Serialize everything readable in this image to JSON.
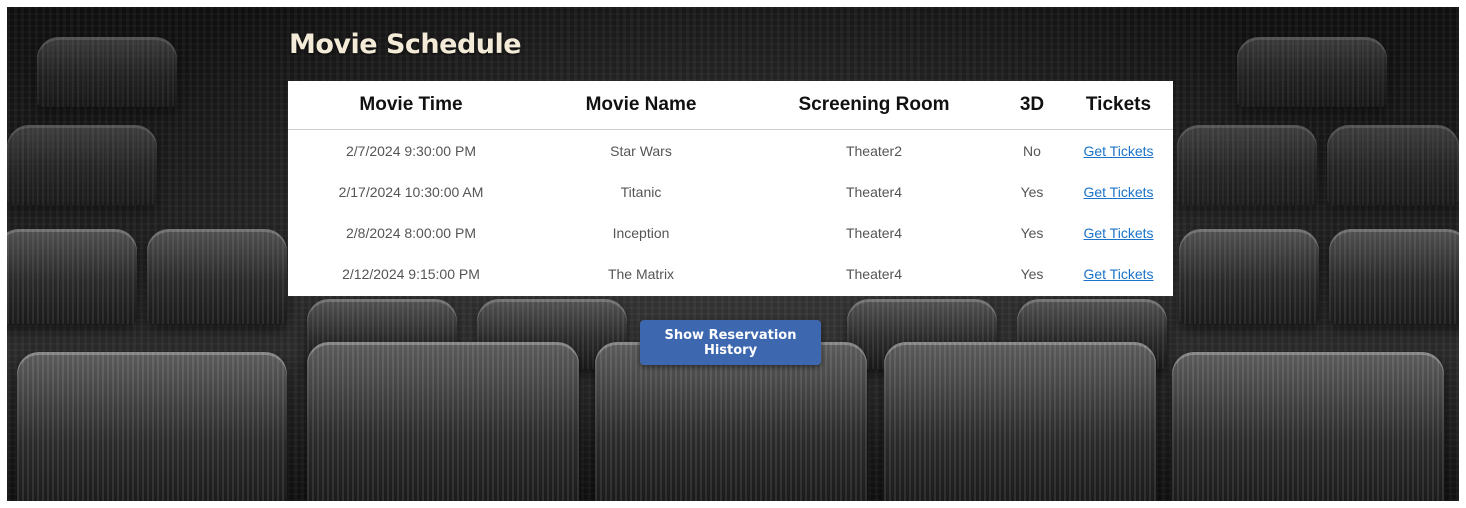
{
  "page": {
    "title": "Movie Schedule"
  },
  "schedule": {
    "headers": {
      "time": "Movie Time",
      "name": "Movie Name",
      "room": "Screening Room",
      "three_d": "3D",
      "tickets": "Tickets"
    },
    "rows": [
      {
        "time": "2/7/2024 9:30:00 PM",
        "name": "Star Wars",
        "room": "Theater2",
        "three_d": "No",
        "tickets": "Get Tickets"
      },
      {
        "time": "2/17/2024 10:30:00 AM",
        "name": "Titanic",
        "room": "Theater4",
        "three_d": "Yes",
        "tickets": "Get Tickets"
      },
      {
        "time": "2/8/2024 8:00:00 PM",
        "name": "Inception",
        "room": "Theater4",
        "three_d": "Yes",
        "tickets": "Get Tickets"
      },
      {
        "time": "2/12/2024 9:15:00 PM",
        "name": "The Matrix",
        "room": "Theater4",
        "three_d": "Yes",
        "tickets": "Get Tickets"
      }
    ]
  },
  "actions": {
    "history_button": "Show Reservation History"
  },
  "colors": {
    "title_text": "#f3ead8",
    "link": "#1a73c9",
    "button": "#3d68b0"
  }
}
